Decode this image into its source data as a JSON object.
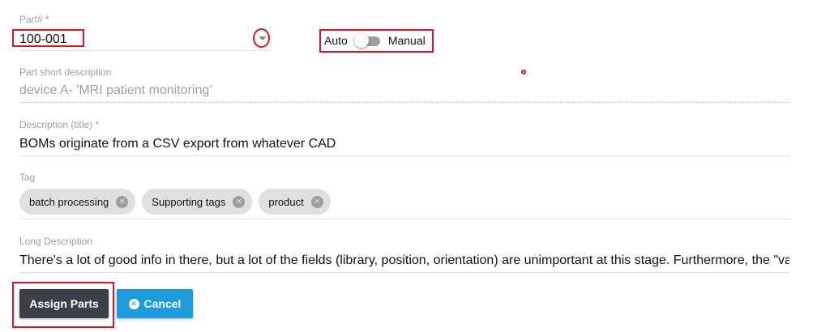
{
  "part": {
    "label": "Part# *",
    "value": "100-001"
  },
  "mode_toggle": {
    "left_label": "Auto",
    "right_label": "Manual",
    "state": "Auto"
  },
  "short_description": {
    "label": "Part short description",
    "value": "device A- 'MRI patient monitoring'"
  },
  "title": {
    "label": "Description (title) *",
    "value": "BOMs originate from a CSV export from whatever CAD"
  },
  "tags": {
    "label": "Tag",
    "items": [
      {
        "text": "batch processing"
      },
      {
        "text": "Supporting tags"
      },
      {
        "text": "product"
      }
    ]
  },
  "long_description": {
    "label": "Long Description",
    "value": "There's a lot of good info in there, but a lot of the fields (library, position, orientation) are unimportant at this stage. Furthermore, the \"va"
  },
  "actions": {
    "assign_label": "Assign Parts",
    "cancel_label": "Cancel"
  },
  "icons": {
    "dropdown": "chevron-down-icon",
    "chip_remove": "remove-circle-icon",
    "cancel": "cancel-circle-icon"
  },
  "colors": {
    "annotation": "#e0141e",
    "assign_button": "#3b3f48",
    "cancel_button": "#1e9bdd",
    "chip_bg": "#e0e0e0"
  }
}
